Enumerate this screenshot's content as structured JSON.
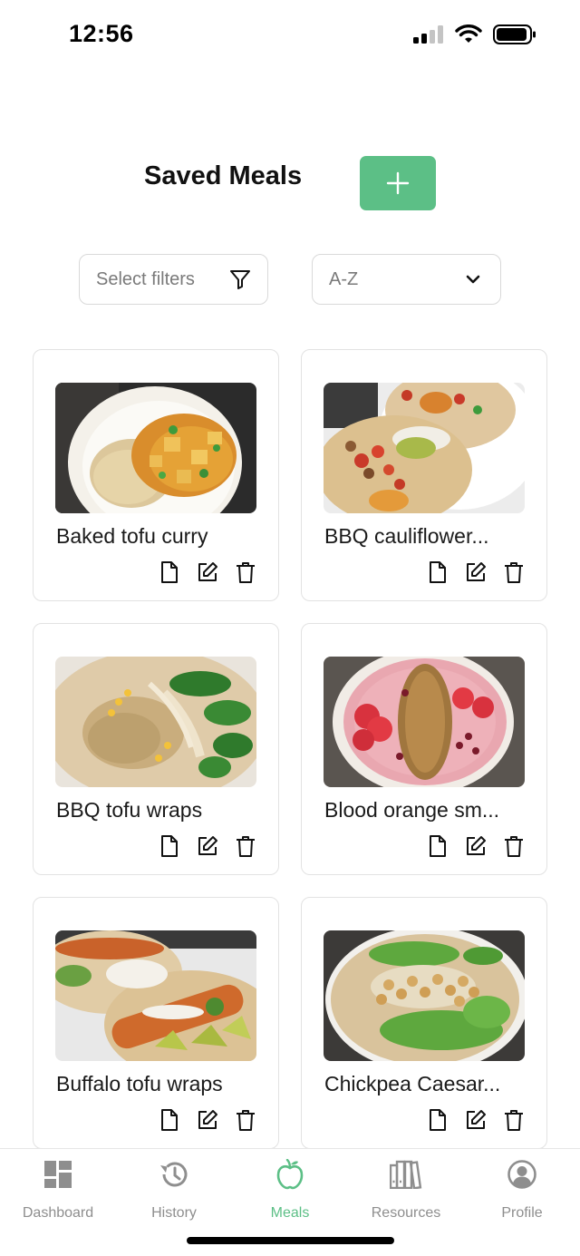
{
  "status_bar": {
    "time": "12:56"
  },
  "header": {
    "title": "Saved Meals",
    "add_button_icon": "plus-icon"
  },
  "controls": {
    "filter_placeholder": "Select filters",
    "filter_icon": "filter-icon",
    "sort_value": "A-Z",
    "sort_icon": "chevron-down-icon"
  },
  "meals": [
    {
      "name": "Baked tofu curry"
    },
    {
      "name": "BBQ cauliflower..."
    },
    {
      "name": "BBQ tofu wraps"
    },
    {
      "name": "Blood orange sm..."
    },
    {
      "name": "Buffalo tofu wraps"
    },
    {
      "name": "Chickpea Caesar..."
    }
  ],
  "card_action_icons": [
    "document-icon",
    "edit-icon",
    "trash-icon"
  ],
  "nav": {
    "items": [
      {
        "label": "Dashboard",
        "icon": "dashboard-icon"
      },
      {
        "label": "History",
        "icon": "history-icon"
      },
      {
        "label": "Meals",
        "icon": "apple-icon"
      },
      {
        "label": "Resources",
        "icon": "books-icon"
      },
      {
        "label": "Profile",
        "icon": "profile-icon"
      }
    ],
    "active": "Meals"
  },
  "colors": {
    "accent": "#5cbf86",
    "border": "#e2e2e2",
    "muted": "#8e8e8e"
  }
}
